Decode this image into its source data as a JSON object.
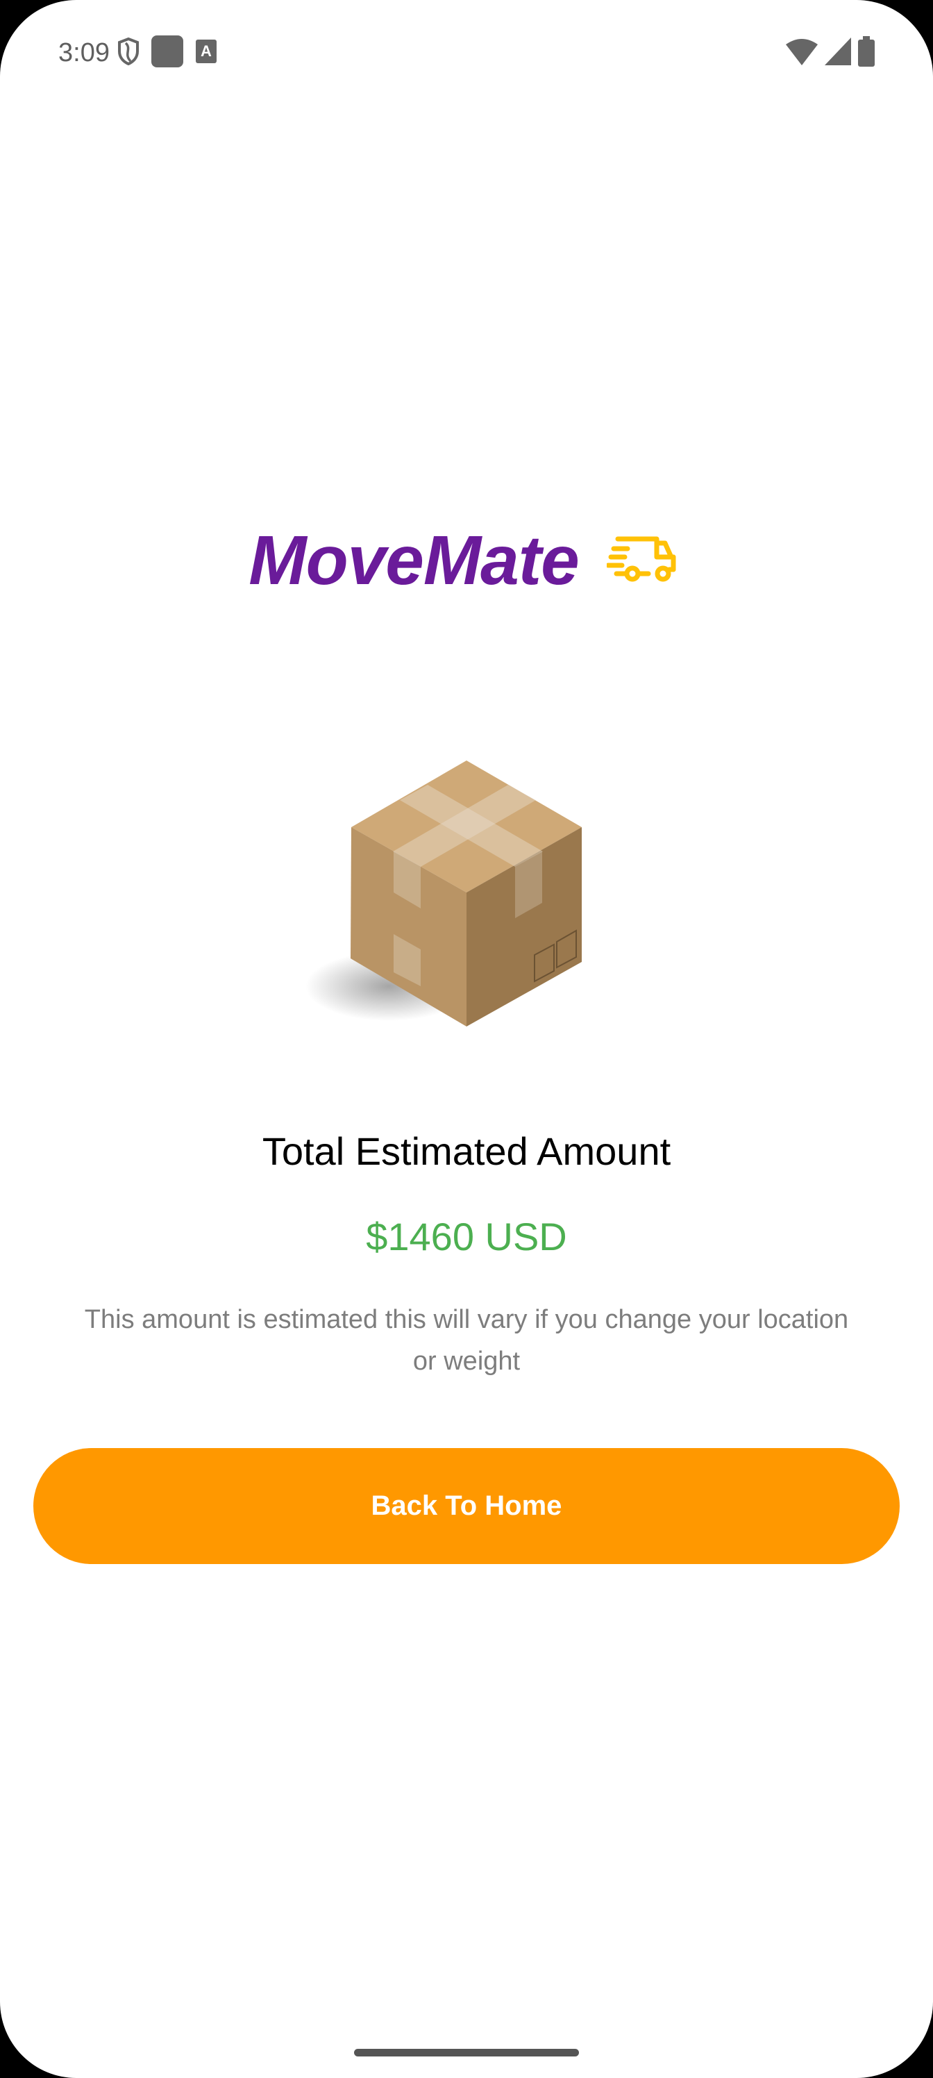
{
  "status_bar": {
    "time": "3:09",
    "icons": [
      "shield-icon",
      "square-icon",
      "font-a-icon",
      "wifi-icon",
      "signal-icon",
      "battery-icon"
    ]
  },
  "logo": {
    "text": "MoveMate",
    "icon": "fast-truck-icon",
    "text_color": "#6a1b9a",
    "icon_color": "#ffc107"
  },
  "main": {
    "title": "Total Estimated Amount",
    "amount": "$1460 USD",
    "amount_color": "#4caf50",
    "description": "This amount is estimated this will vary if you change your location or weight",
    "back_button": "Back To Home",
    "button_color": "#ff9800"
  }
}
